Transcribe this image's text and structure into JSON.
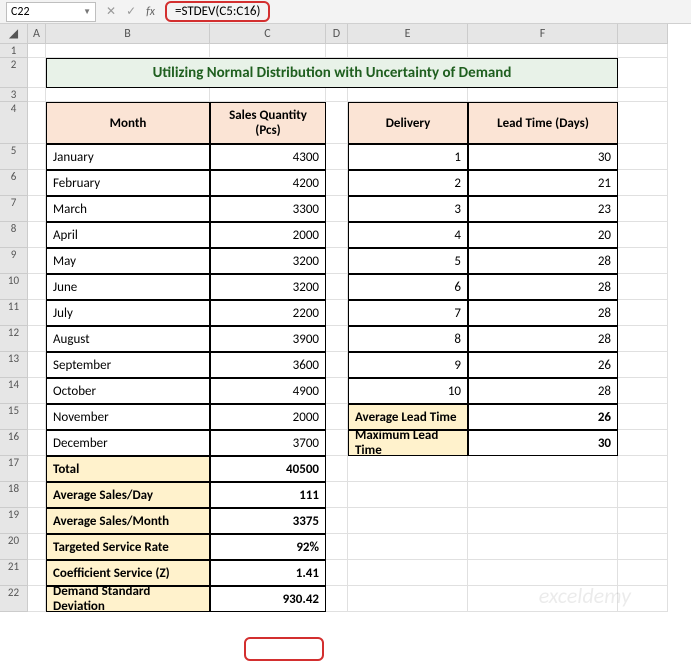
{
  "namebox": "C22",
  "formula": "=STDEV(C5:C16)",
  "fx_label": "fx",
  "title": "Utilizing Normal Distribution with Uncertainty of Demand",
  "cols": [
    "A",
    "B",
    "C",
    "D",
    "E",
    "F"
  ],
  "rows": [
    "1",
    "2",
    "3",
    "4",
    "5",
    "6",
    "7",
    "8",
    "9",
    "10",
    "11",
    "12",
    "13",
    "14",
    "15",
    "16",
    "17",
    "18",
    "19",
    "20",
    "21",
    "22"
  ],
  "left_head": {
    "m": "Month",
    "q": "Sales Quantity (Pcs)"
  },
  "right_head": {
    "d": "Delivery",
    "l": "Lead Time (Days)"
  },
  "months": [
    {
      "m": "January",
      "q": "4300"
    },
    {
      "m": "February",
      "q": "4200"
    },
    {
      "m": "March",
      "q": "3300"
    },
    {
      "m": "April",
      "q": "2000"
    },
    {
      "m": "May",
      "q": "3200"
    },
    {
      "m": "June",
      "q": "3200"
    },
    {
      "m": "July",
      "q": "2200"
    },
    {
      "m": "August",
      "q": "3900"
    },
    {
      "m": "September",
      "q": "3600"
    },
    {
      "m": "October",
      "q": "4900"
    },
    {
      "m": "November",
      "q": "2000"
    },
    {
      "m": "December",
      "q": "3700"
    }
  ],
  "deliveries": [
    {
      "d": "1",
      "l": "30"
    },
    {
      "d": "2",
      "l": "21"
    },
    {
      "d": "3",
      "l": "23"
    },
    {
      "d": "4",
      "l": "20"
    },
    {
      "d": "5",
      "l": "28"
    },
    {
      "d": "6",
      "l": "28"
    },
    {
      "d": "7",
      "l": "28"
    },
    {
      "d": "8",
      "l": "28"
    },
    {
      "d": "9",
      "l": "26"
    },
    {
      "d": "10",
      "l": "28"
    }
  ],
  "right_summary": [
    {
      "label": "Average Lead Time",
      "value": "26"
    },
    {
      "label": "Maximum Lead Time",
      "value": "30"
    }
  ],
  "left_summary": [
    {
      "label": "Total",
      "value": "40500"
    },
    {
      "label": "Average Sales/Day",
      "value": "111"
    },
    {
      "label": "Average Sales/Month",
      "value": "3375"
    },
    {
      "label": "Targeted Service Rate",
      "value": "92%"
    },
    {
      "label": "Coefficient Service (Z)",
      "value": "1.41"
    },
    {
      "label": "Demand Standard Deviation",
      "value": "930.42"
    }
  ],
  "watermark": "exceldemy",
  "chart_data": {
    "type": "table",
    "title": "Utilizing Normal Distribution with Uncertainty of Demand",
    "tables": [
      {
        "columns": [
          "Month",
          "Sales Quantity (Pcs)"
        ],
        "rows": [
          [
            "January",
            4300
          ],
          [
            "February",
            4200
          ],
          [
            "March",
            3300
          ],
          [
            "April",
            2000
          ],
          [
            "May",
            3200
          ],
          [
            "June",
            3200
          ],
          [
            "July",
            2200
          ],
          [
            "August",
            3900
          ],
          [
            "September",
            3600
          ],
          [
            "October",
            4900
          ],
          [
            "November",
            2000
          ],
          [
            "December",
            3700
          ]
        ],
        "summary": {
          "Total": 40500,
          "Average Sales/Day": 111,
          "Average Sales/Month": 3375,
          "Targeted Service Rate": 0.92,
          "Coefficient Service (Z)": 1.41,
          "Demand Standard Deviation": 930.42
        }
      },
      {
        "columns": [
          "Delivery",
          "Lead Time (Days)"
        ],
        "rows": [
          [
            1,
            30
          ],
          [
            2,
            21
          ],
          [
            3,
            23
          ],
          [
            4,
            20
          ],
          [
            5,
            28
          ],
          [
            6,
            28
          ],
          [
            7,
            28
          ],
          [
            8,
            28
          ],
          [
            9,
            26
          ],
          [
            10,
            28
          ]
        ],
        "summary": {
          "Average Lead Time": 26,
          "Maximum Lead Time": 30
        }
      }
    ]
  }
}
